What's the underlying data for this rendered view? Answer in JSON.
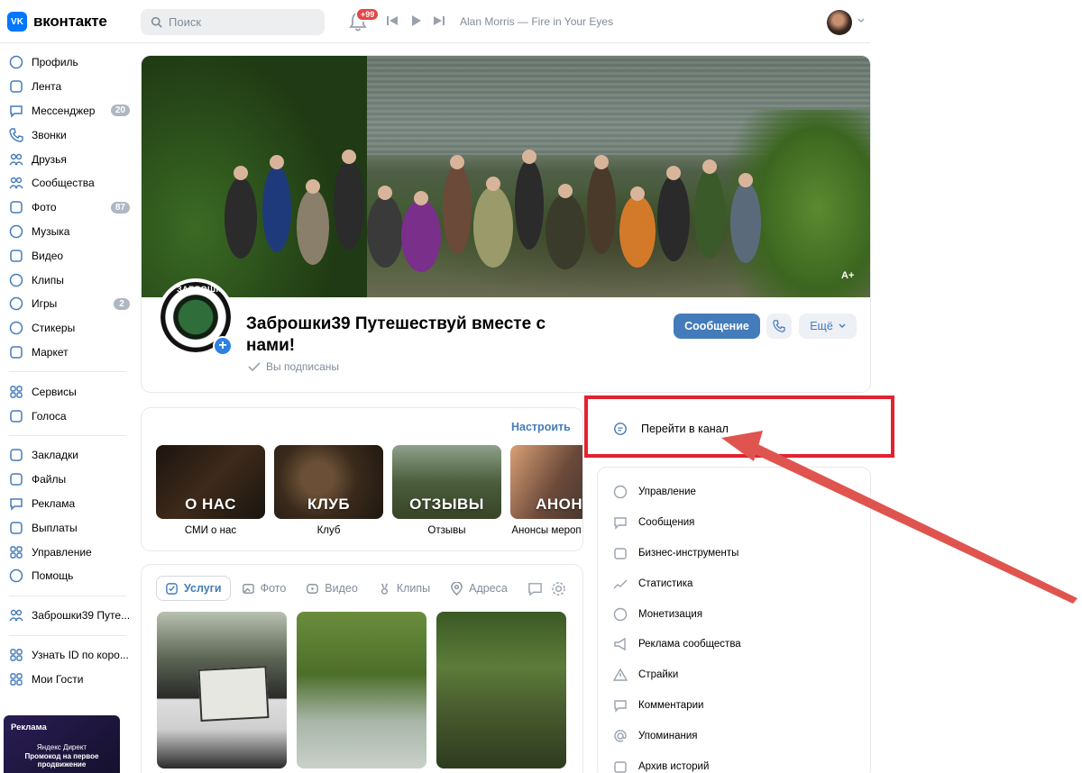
{
  "header": {
    "logo_text": "вконтакте",
    "logo_badge": "VK",
    "search_placeholder": "Поиск",
    "notifications_badge": "+99",
    "now_playing": "Alan Morris — Fire in Your Eyes"
  },
  "sidebar": {
    "items": [
      {
        "label": "Профиль",
        "icon": "user-circle-icon",
        "count": ""
      },
      {
        "label": "Лента",
        "icon": "news-feed-icon",
        "count": ""
      },
      {
        "label": "Мессенджер",
        "icon": "message-icon",
        "count": "20"
      },
      {
        "label": "Звонки",
        "icon": "phone-icon",
        "count": ""
      },
      {
        "label": "Друзья",
        "icon": "friends-icon",
        "count": ""
      },
      {
        "label": "Сообщества",
        "icon": "communities-icon",
        "count": ""
      },
      {
        "label": "Фото",
        "icon": "photo-icon",
        "count": "87"
      },
      {
        "label": "Музыка",
        "icon": "music-icon",
        "count": ""
      },
      {
        "label": "Видео",
        "icon": "video-icon",
        "count": ""
      },
      {
        "label": "Клипы",
        "icon": "clips-icon",
        "count": ""
      },
      {
        "label": "Игры",
        "icon": "games-icon",
        "count": "2"
      },
      {
        "label": "Стикеры",
        "icon": "smile-icon",
        "count": ""
      },
      {
        "label": "Маркет",
        "icon": "market-icon",
        "count": ""
      }
    ],
    "items2": [
      {
        "label": "Сервисы",
        "icon": "services-icon"
      },
      {
        "label": "Голоса",
        "icon": "votes-icon"
      }
    ],
    "items3": [
      {
        "label": "Закладки",
        "icon": "bookmark-icon"
      },
      {
        "label": "Файлы",
        "icon": "file-icon"
      },
      {
        "label": "Реклама",
        "icon": "megaphone-icon"
      },
      {
        "label": "Выплаты",
        "icon": "payouts-icon"
      },
      {
        "label": "Управление",
        "icon": "grid-icon"
      },
      {
        "label": "Помощь",
        "icon": "help-icon"
      }
    ],
    "items4": [
      {
        "label": "Заброшки39 Путе...",
        "icon": "community-icon"
      }
    ],
    "items5": [
      {
        "label": "Узнать ID по коро...",
        "icon": "app-icon"
      },
      {
        "label": "Мои Гости",
        "icon": "app-icon"
      }
    ],
    "ad": {
      "title": "Реклама",
      "brand": "Яндекс Директ",
      "promo": "Промокод на первое продвижение"
    }
  },
  "group": {
    "name": "Заброшки39 Путешествуй вместе с нами!",
    "avatar_text": "ЗАБРОШКИ39",
    "subscribed": "Вы подписаны",
    "message_button": "Сообщение",
    "more_button": "Ещё",
    "cover_badge": "A+"
  },
  "playlists": {
    "configure": "Настроить",
    "items": [
      {
        "overlay": "О НАС",
        "caption": "СМИ о нас"
      },
      {
        "overlay": "КЛУБ",
        "caption": "Клуб"
      },
      {
        "overlay": "ОТЗЫВЫ",
        "caption": "Отзывы"
      },
      {
        "overlay": "АНОНС",
        "caption": "Анонсы мероп"
      }
    ]
  },
  "tabs": [
    {
      "label": "Услуги",
      "icon": "check-square-icon"
    },
    {
      "label": "Фото",
      "icon": "photo-icon"
    },
    {
      "label": "Видео",
      "icon": "video-icon"
    },
    {
      "label": "Клипы",
      "icon": "clips-icon"
    },
    {
      "label": "Адреса",
      "icon": "pin-icon"
    }
  ],
  "right_menu": {
    "channel_link": "Перейти в канал",
    "items": [
      {
        "label": "Управление",
        "icon": "gear-icon"
      },
      {
        "label": "Сообщения",
        "icon": "message-icon"
      },
      {
        "label": "Бизнес-инструменты",
        "icon": "bag-icon"
      },
      {
        "label": "Статистика",
        "icon": "stats-icon"
      },
      {
        "label": "Монетизация",
        "icon": "coin-icon"
      },
      {
        "label": "Реклама сообщества",
        "icon": "megaphone-icon"
      },
      {
        "label": "Страйки",
        "icon": "warning-icon"
      },
      {
        "label": "Комментарии",
        "icon": "comment-icon"
      },
      {
        "label": "Упоминания",
        "icon": "at-icon"
      },
      {
        "label": "Архив историй",
        "icon": "archive-icon"
      }
    ]
  },
  "colors": {
    "accent": "#447bba",
    "brand": "#0077ff",
    "highlight": "#e1232f",
    "badge": "#e64646"
  }
}
